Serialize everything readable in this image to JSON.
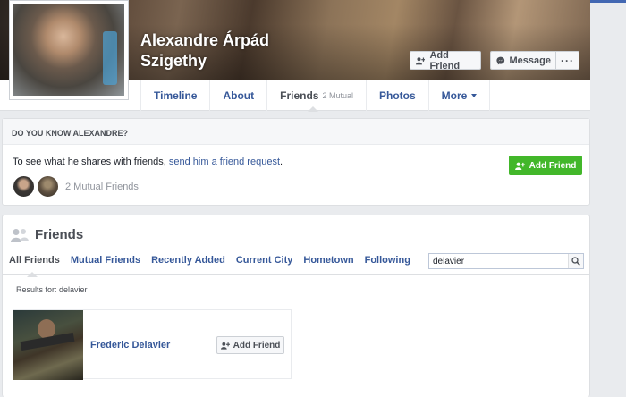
{
  "profile": {
    "name_line1": "Alexandre Árpád",
    "name_line2": "Szigethy"
  },
  "cover_actions": {
    "add_friend": "Add Friend",
    "message": "Message",
    "more": "···"
  },
  "nav": {
    "items": [
      {
        "label": "Timeline"
      },
      {
        "label": "About"
      },
      {
        "label": "Friends",
        "sub": "2 Mutual"
      },
      {
        "label": "Photos"
      },
      {
        "label": "More"
      }
    ]
  },
  "know_card": {
    "header": "DO YOU KNOW ALEXANDRE?",
    "text_prefix": "To see what he shares with friends, ",
    "link_text": "send him a friend request",
    "text_suffix": ".",
    "mutual_count": "2 Mutual Friends",
    "add_friend": "Add Friend"
  },
  "friends": {
    "title": "Friends",
    "tabs": [
      "All Friends",
      "Mutual Friends",
      "Recently Added",
      "Current City",
      "Hometown",
      "Following"
    ],
    "search_value": "delavier",
    "results_label": "Results for: delavier",
    "results": [
      {
        "name": "Frederic Delavier",
        "action": "Add Friend"
      }
    ]
  },
  "colors": {
    "link": "#365899",
    "green_button": "#42b72a",
    "background": "#e9ebee"
  },
  "icons": [
    "add-friend-icon",
    "messenger-icon",
    "friends-icon",
    "search-icon",
    "caret-down-icon"
  ]
}
